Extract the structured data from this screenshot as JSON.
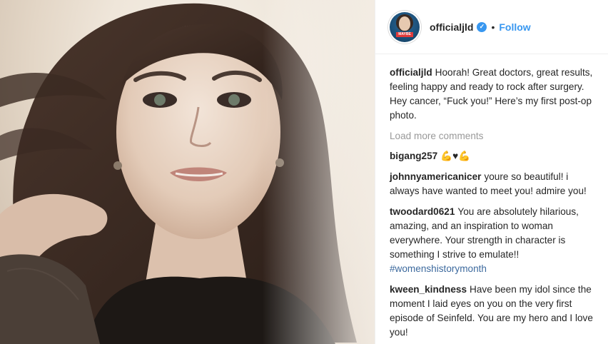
{
  "post": {
    "username": "officialjld",
    "verified_icon": "verified-badge-icon",
    "separator": "•",
    "follow_label": "Follow",
    "avatar_badge_text": "MAYBE",
    "caption_user": "officialjld",
    "caption_text": "Hoorah! Great doctors, great results, feeling happy and ready to rock after surgery. Hey cancer, “Fuck you!” Here’s my first post-op photo."
  },
  "load_more_label": "Load more comments",
  "comments": [
    {
      "user": "bigang257",
      "text": "💪♥💪"
    },
    {
      "user": "johnnyamericanicer",
      "text": "youre so beautiful! i always have wanted to meet you! admire you!"
    },
    {
      "user": "twoodard0621",
      "text": "You are absolutely hilarious, amazing, and an inspiration to woman everywhere. Your strength in character is something I strive to emulate!!",
      "hashtag": "#womenshistorymonth"
    },
    {
      "user": "kween_kindness",
      "text": "Have been my idol since the moment I laid eyes on you on the very first episode of Seinfeld. You are my hero and I love you!"
    }
  ],
  "colors": {
    "link": "#3897f0",
    "hashtag": "#3d6a9e",
    "muted": "#999999",
    "text": "#262626"
  }
}
